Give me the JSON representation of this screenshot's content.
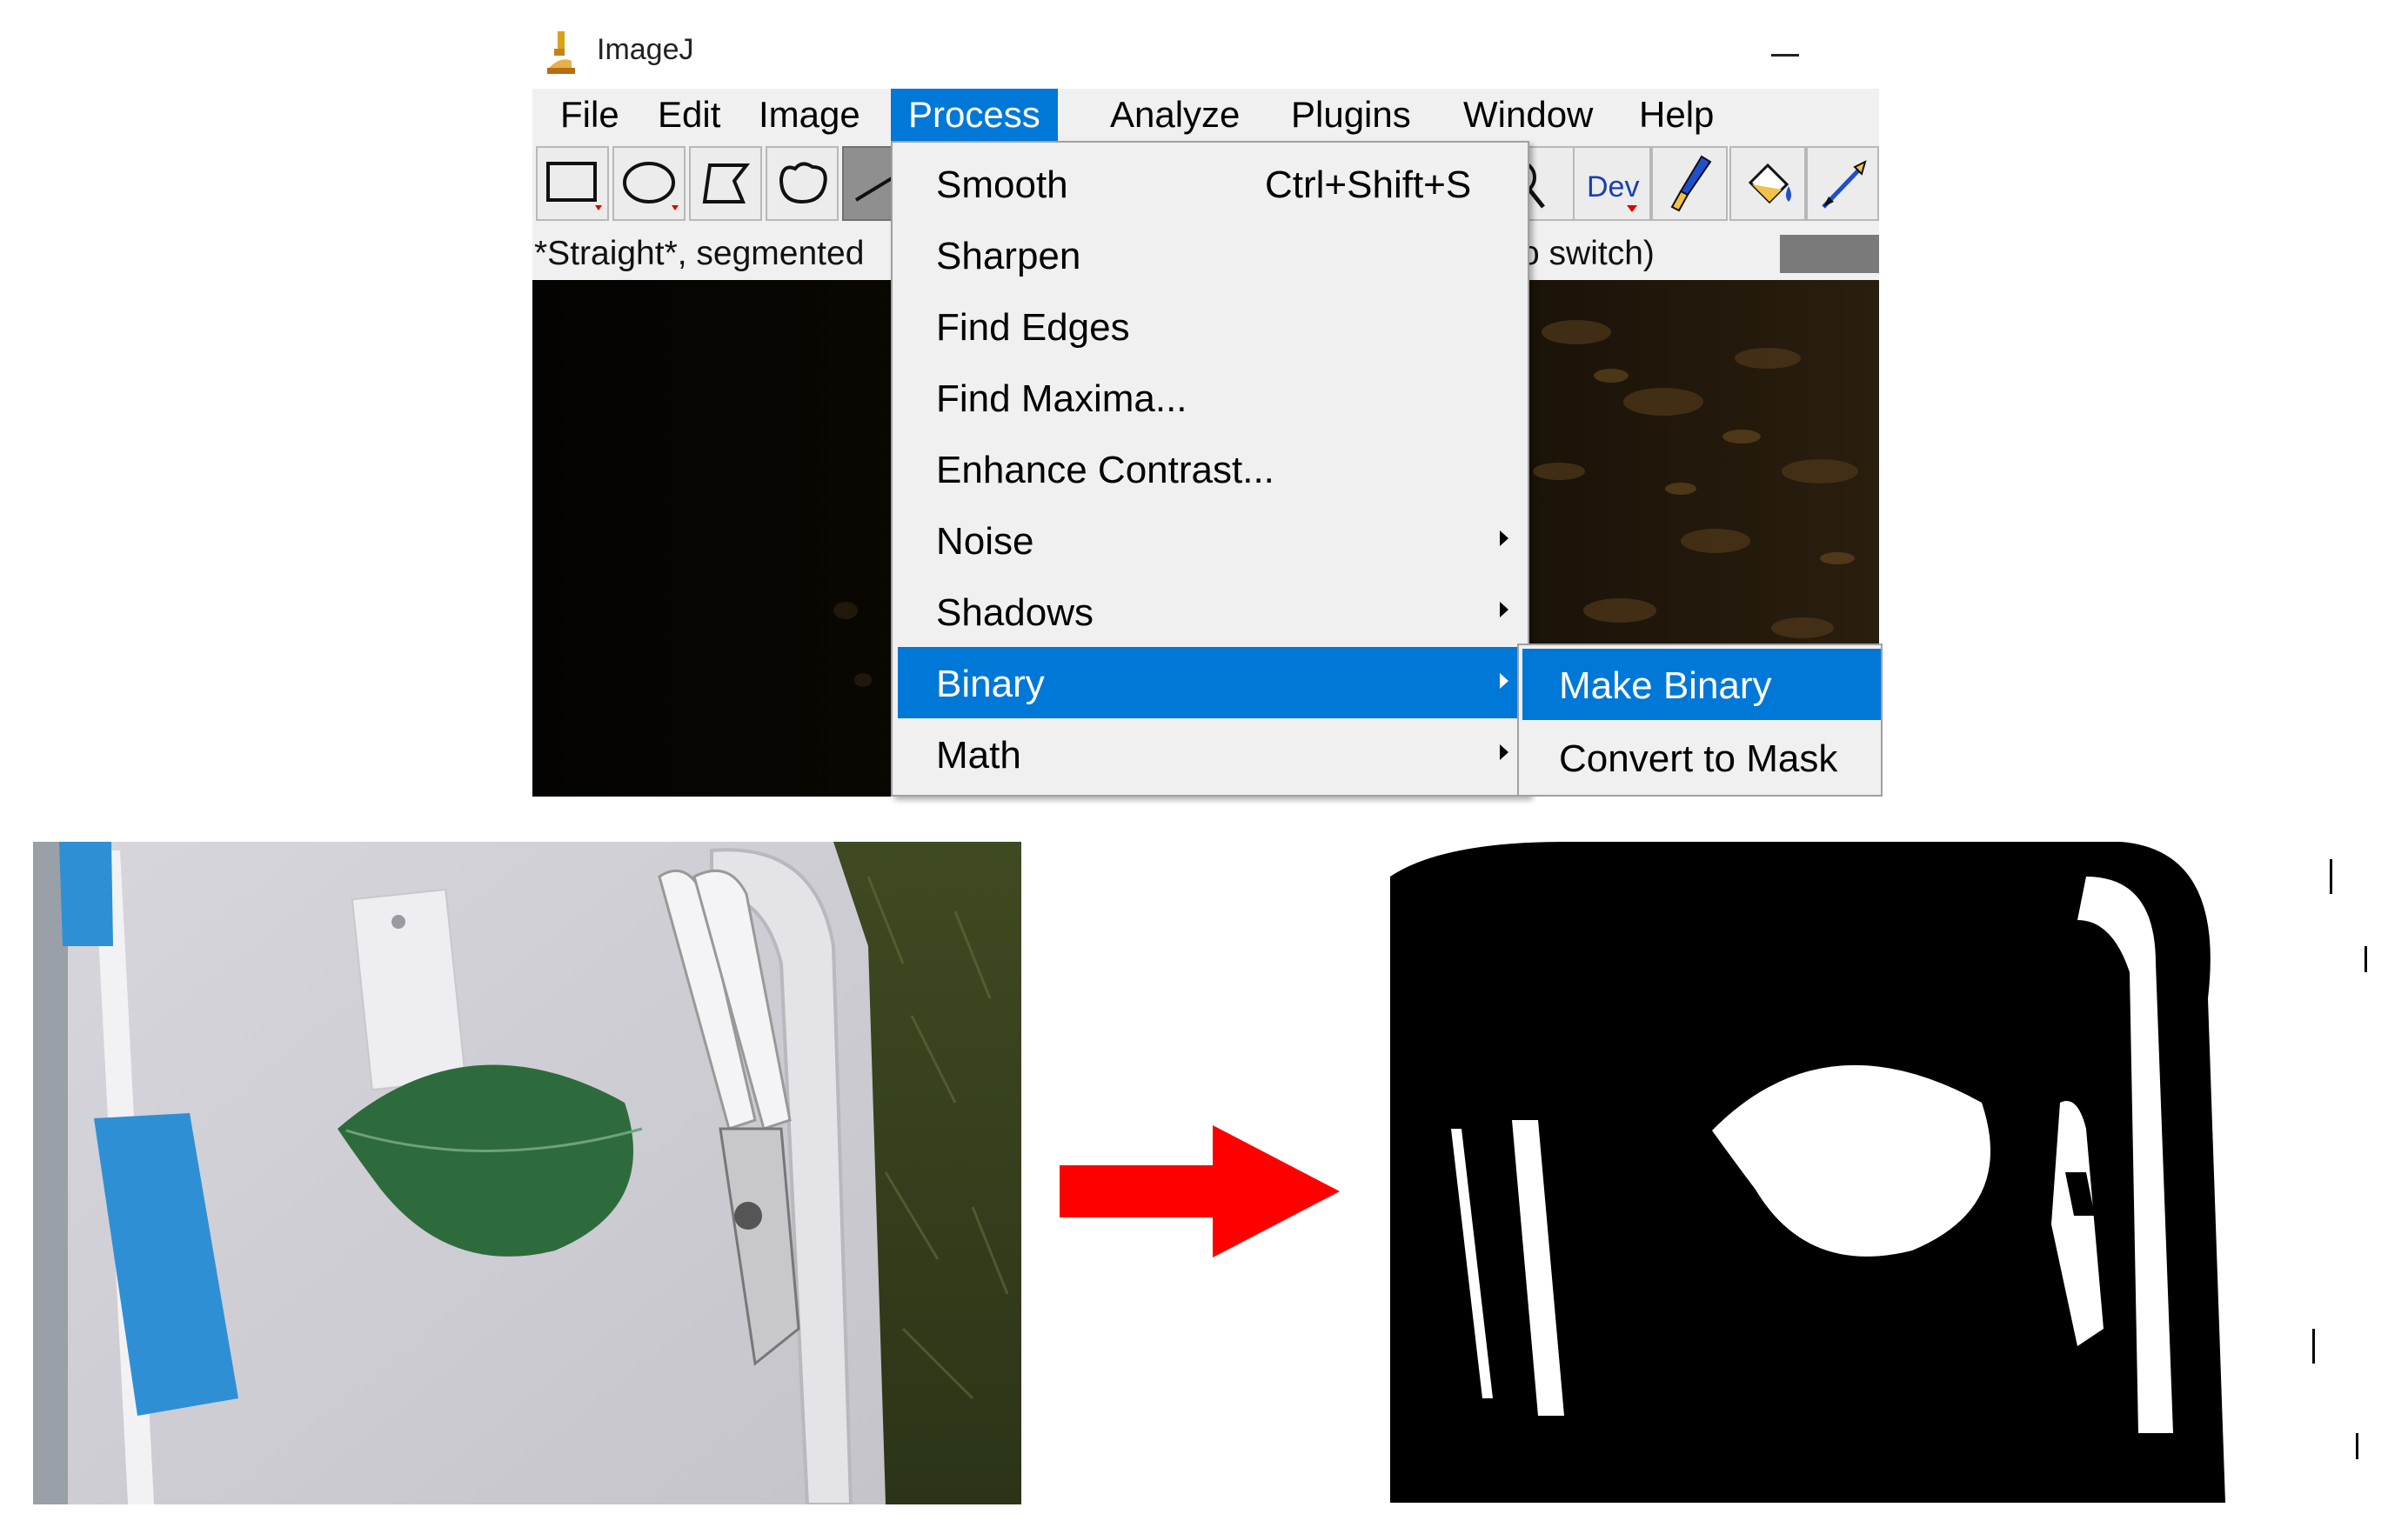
{
  "window": {
    "title": "ImageJ"
  },
  "menubar": {
    "items": [
      "File",
      "Edit",
      "Image",
      "Process",
      "Analyze",
      "Plugins",
      "Window",
      "Help"
    ],
    "active": "Process"
  },
  "toolbar": {
    "tools": [
      "rectangle",
      "oval",
      "polygon",
      "freehand",
      "straight-line",
      "magnifier",
      "developer-menu",
      "brush",
      "flood-filler",
      "pencil-pick"
    ],
    "dev_label": "Dev"
  },
  "status": {
    "left_text": "*Straight*, segmented",
    "right_text": "o switch)"
  },
  "process_menu": {
    "items": [
      {
        "label": "Smooth",
        "shortcut": "Ctrl+Shift+S",
        "submenu": false
      },
      {
        "label": "Sharpen",
        "shortcut": "",
        "submenu": false
      },
      {
        "label": "Find Edges",
        "shortcut": "",
        "submenu": false
      },
      {
        "label": "Find Maxima...",
        "shortcut": "",
        "submenu": false
      },
      {
        "label": "Enhance Contrast...",
        "shortcut": "",
        "submenu": false
      },
      {
        "label": "Noise",
        "shortcut": "",
        "submenu": true
      },
      {
        "label": "Shadows",
        "shortcut": "",
        "submenu": true
      },
      {
        "label": "Binary",
        "shortcut": "",
        "submenu": true
      },
      {
        "label": "Math",
        "shortcut": "",
        "submenu": true
      }
    ],
    "active": "Binary"
  },
  "binary_submenu": {
    "items": [
      "Make Binary",
      "Convert to Mask"
    ],
    "active": "Make Binary"
  },
  "colors": {
    "menu_highlight": "#0078d7",
    "menu_background": "#f0f0f0",
    "arrow": "#ff0000",
    "leaf": "#2e6b3c",
    "handle_blue": "#2f8fd4"
  }
}
